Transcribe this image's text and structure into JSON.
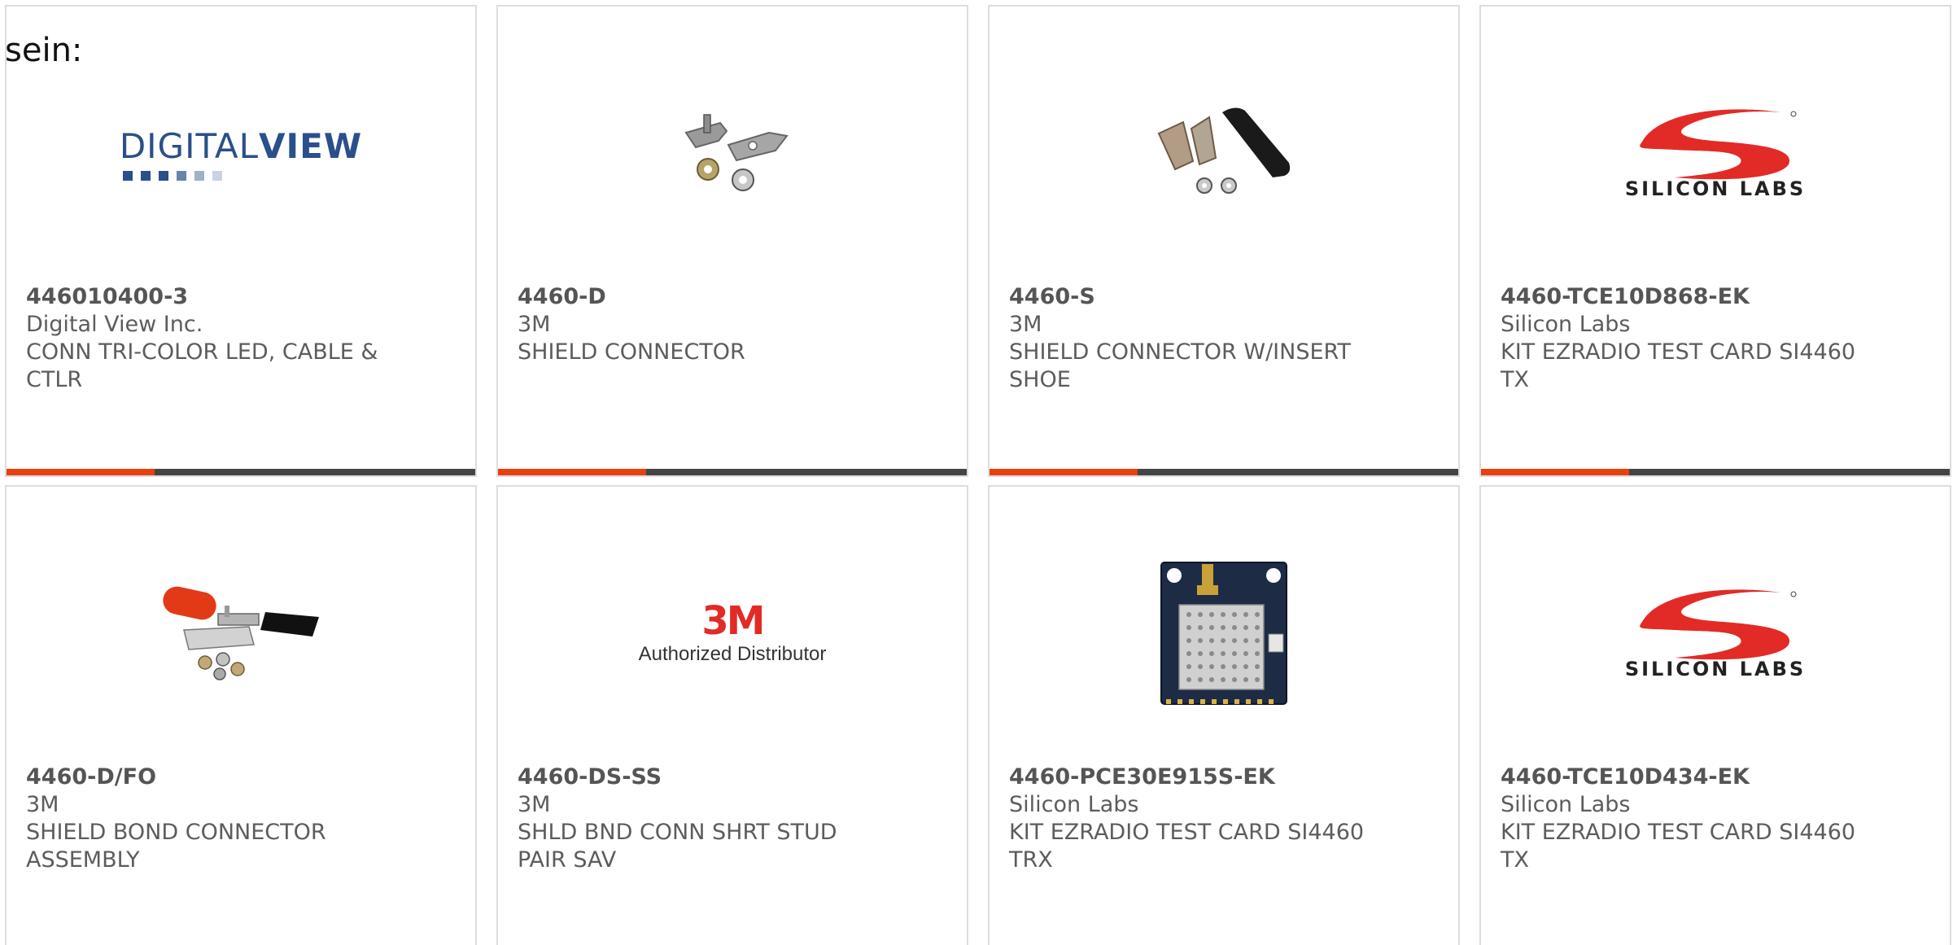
{
  "intro_text": "sein:",
  "products": [
    {
      "part_number": "446010400-3",
      "manufacturer": "Digital View Inc.",
      "description_line1": "CONN TRI-COLOR LED, CABLE &",
      "description_line2": "CTLR",
      "image": "digital-view-logo",
      "logo_word_regular": "DIGITAL",
      "logo_word_bold": "VIEW"
    },
    {
      "part_number": "4460-D",
      "manufacturer": "3M",
      "description_line1": "SHIELD CONNECTOR",
      "description_line2": "",
      "image": "shield-connector-photo"
    },
    {
      "part_number": "4460-S",
      "manufacturer": "3M",
      "description_line1": "SHIELD CONNECTOR W/INSERT",
      "description_line2": "SHOE",
      "image": "shield-connector-insert-photo"
    },
    {
      "part_number": "4460-TCE10D868-EK",
      "manufacturer": "Silicon Labs",
      "description_line1": "KIT EZRADIO TEST CARD SI4460",
      "description_line2": "TX",
      "image": "silicon-labs-logo",
      "logo_text": "SILICON LABS"
    },
    {
      "part_number": "4460-D/FO",
      "manufacturer": "3M",
      "description_line1": "SHIELD BOND CONNECTOR",
      "description_line2": "ASSEMBLY",
      "image": "shield-bond-assembly-photo"
    },
    {
      "part_number": "4460-DS-SS",
      "manufacturer": "3M",
      "description_line1": "SHLD BND CONN SHRT STUD",
      "description_line2": "PAIR SAV",
      "image": "3m-authorized-distributor-logo",
      "logo_big": "3M",
      "logo_small": "Authorized Distributor"
    },
    {
      "part_number": "4460-PCE30E915S-EK",
      "manufacturer": "Silicon Labs",
      "description_line1": "KIT EZRADIO TEST CARD SI4460",
      "description_line2": "TRX",
      "image": "radio-test-card-photo"
    },
    {
      "part_number": "4460-TCE10D434-EK",
      "manufacturer": "Silicon Labs",
      "description_line1": "KIT EZRADIO TEST CARD SI4460",
      "description_line2": "TX",
      "image": "silicon-labs-logo",
      "logo_text": "SILICON LABS"
    }
  ],
  "colors": {
    "accent": "#e8410f",
    "bar": "#444444",
    "text": "#5c5c5c",
    "card_border": "#dddddd",
    "digital_view_blue": "#2b4f8a",
    "silicon_labs_red": "#e22b26",
    "three_m_red": "#e22b26"
  }
}
